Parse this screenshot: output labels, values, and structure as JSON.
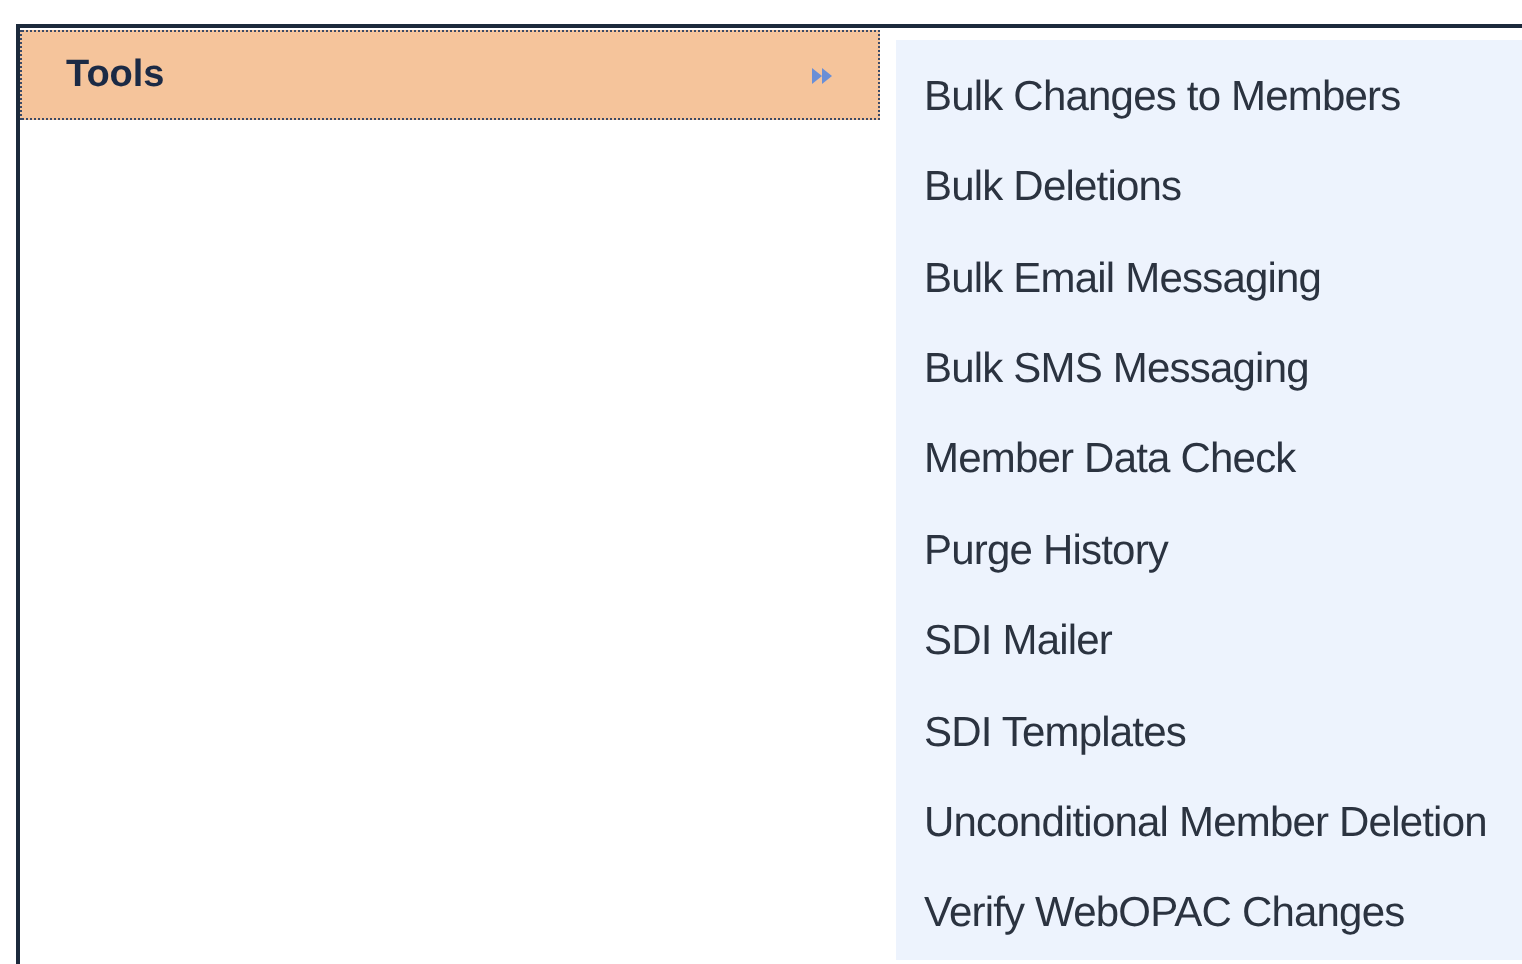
{
  "menu": {
    "items": [
      {
        "label": "Tools",
        "selected": true
      }
    ]
  },
  "submenu": {
    "items": [
      {
        "label": "Bulk Changes to Members"
      },
      {
        "label": "Bulk Deletions"
      },
      {
        "label": "Bulk Email Messaging"
      },
      {
        "label": "Bulk SMS Messaging"
      },
      {
        "label": "Member Data Check"
      },
      {
        "label": "Purge History"
      },
      {
        "label": "SDI Mailer"
      },
      {
        "label": "SDI Templates"
      },
      {
        "label": "Unconditional Member Deletion"
      },
      {
        "label": "Verify WebOPAC Changes"
      }
    ]
  }
}
